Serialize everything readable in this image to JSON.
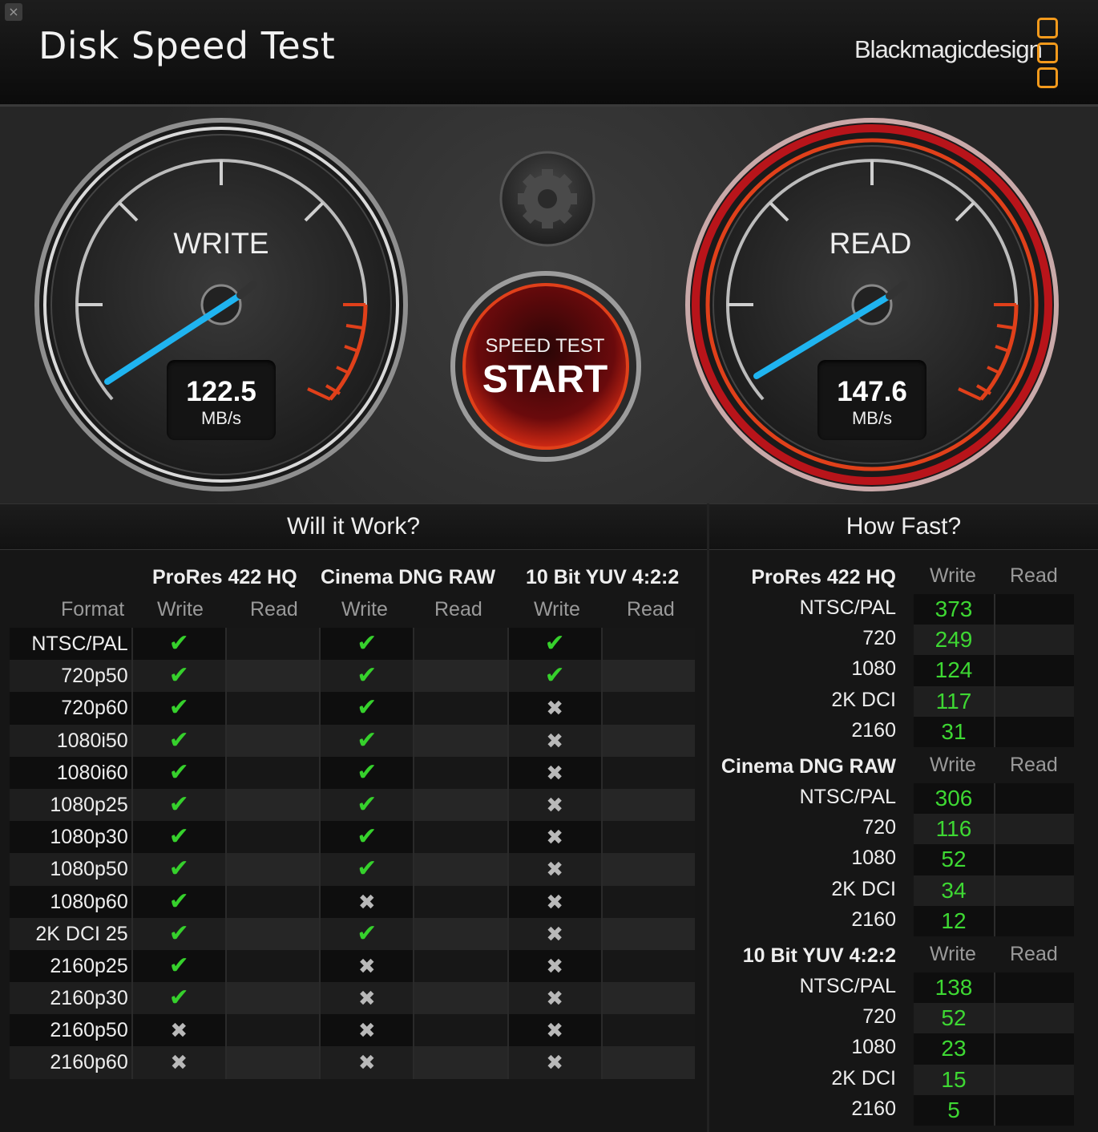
{
  "window": {
    "close_icon": "close-icon",
    "title": "Disk Speed Test",
    "brand": "Blackmagicdesign"
  },
  "gauges": {
    "write": {
      "label": "WRITE",
      "value": "122.5",
      "unit": "MB/s"
    },
    "read": {
      "label": "READ",
      "value": "147.6",
      "unit": "MB/s"
    }
  },
  "start_button": {
    "small": "SPEED TEST",
    "big": "START"
  },
  "settings_icon": "gear-icon",
  "colors": {
    "needle": "#1fb4f0",
    "ok": "#36d12c",
    "value_green": "#3ed833",
    "brand_orange": "#f39a1c",
    "accent_red": "#c4161c"
  },
  "will_it_work": {
    "heading": "Will it Work?",
    "format_header": "Format",
    "codecs": [
      {
        "name": "ProRes 422 HQ",
        "write": "Write",
        "read": "Read"
      },
      {
        "name": "Cinema DNG RAW",
        "write": "Write",
        "read": "Read"
      },
      {
        "name": "10 Bit YUV 4:2:2",
        "write": "Write",
        "read": "Read"
      }
    ],
    "rows": [
      {
        "format": "NTSC/PAL",
        "marks": [
          "ok",
          "ok",
          "ok"
        ]
      },
      {
        "format": "720p50",
        "marks": [
          "ok",
          "ok",
          "ok"
        ]
      },
      {
        "format": "720p60",
        "marks": [
          "ok",
          "ok",
          "no"
        ]
      },
      {
        "format": "1080i50",
        "marks": [
          "ok",
          "ok",
          "no"
        ]
      },
      {
        "format": "1080i60",
        "marks": [
          "ok",
          "ok",
          "no"
        ]
      },
      {
        "format": "1080p25",
        "marks": [
          "ok",
          "ok",
          "no"
        ]
      },
      {
        "format": "1080p30",
        "marks": [
          "ok",
          "ok",
          "no"
        ]
      },
      {
        "format": "1080p50",
        "marks": [
          "ok",
          "ok",
          "no"
        ]
      },
      {
        "format": "1080p60",
        "marks": [
          "ok",
          "no",
          "no"
        ]
      },
      {
        "format": "2K DCI 25",
        "marks": [
          "ok",
          "ok",
          "no"
        ]
      },
      {
        "format": "2160p25",
        "marks": [
          "ok",
          "no",
          "no"
        ]
      },
      {
        "format": "2160p30",
        "marks": [
          "ok",
          "no",
          "no"
        ]
      },
      {
        "format": "2160p50",
        "marks": [
          "no",
          "no",
          "no"
        ]
      },
      {
        "format": "2160p60",
        "marks": [
          "no",
          "no",
          "no"
        ]
      }
    ]
  },
  "how_fast": {
    "heading": "How Fast?",
    "groups": [
      {
        "name": "ProRes 422 HQ",
        "write": "Write",
        "read": "Read",
        "rows": [
          {
            "label": "NTSC/PAL",
            "write": "373"
          },
          {
            "label": "720",
            "write": "249"
          },
          {
            "label": "1080",
            "write": "124"
          },
          {
            "label": "2K DCI",
            "write": "117"
          },
          {
            "label": "2160",
            "write": "31"
          }
        ]
      },
      {
        "name": "Cinema DNG RAW",
        "write": "Write",
        "read": "Read",
        "rows": [
          {
            "label": "NTSC/PAL",
            "write": "306"
          },
          {
            "label": "720",
            "write": "116"
          },
          {
            "label": "1080",
            "write": "52"
          },
          {
            "label": "2K DCI",
            "write": "34"
          },
          {
            "label": "2160",
            "write": "12"
          }
        ]
      },
      {
        "name": "10 Bit YUV 4:2:2",
        "write": "Write",
        "read": "Read",
        "rows": [
          {
            "label": "NTSC/PAL",
            "write": "138"
          },
          {
            "label": "720",
            "write": "52"
          },
          {
            "label": "1080",
            "write": "23"
          },
          {
            "label": "2K DCI",
            "write": "15"
          },
          {
            "label": "2160",
            "write": "5"
          }
        ]
      }
    ]
  }
}
